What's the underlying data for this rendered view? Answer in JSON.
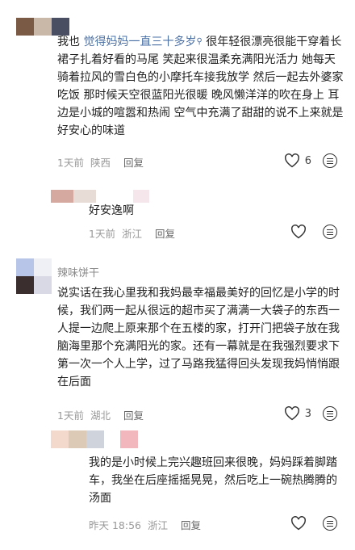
{
  "comments": [
    {
      "name": "",
      "text_prefix": "我也 ",
      "link": "觉得妈妈一直三十多岁",
      "text_rest": " 很年轻很漂亮很能干穿着长裙子扎着好看的马尾 笑起来很温柔充满阳光活力 她每天骑着拉风的雪白色的小摩托车接我放学 然后一起去外婆家吃饭 那时候天空很蓝阳光很暖 晚风懒洋洋的吹在身上 耳边是小城的喧嚣和热闹 空气中充满了甜甜的说不上来就是好安心的味道",
      "time": "1天前",
      "location": "陕西",
      "reply": "回复",
      "likes": "6",
      "avatar_colors": [
        "#7a5a45",
        "#c9b8a8",
        "#4a4e63"
      ]
    },
    {
      "name": "",
      "text": "好安逸啊",
      "time": "1天前",
      "location": "浙江",
      "reply": "回复",
      "likes": "",
      "avatar_colors": [
        "#d6a9a0",
        "#e8dcd6",
        "#f4e6ea"
      ]
    },
    {
      "name": "辣味饼干",
      "text": "说实话在我心里我和我妈最幸福最美好的回忆是小学的时候，我们两一起从很远的超市买了满满一大袋子的东西一人提一边爬上原来那个在五楼的家，打开门把袋子放在我脑海里那个充满阳光的家。还有一幕就是在我强烈要求下第一次一个人上学，过了马路我猛得回头发现我妈悄悄跟在后面",
      "time": "1天前",
      "location": "湖北",
      "reply": "回复",
      "likes": "3",
      "avatar_colors": [
        "#b7c6e8",
        "#3a2f2e",
        "#d9d9e6"
      ]
    },
    {
      "name": "",
      "text": "我的是小时候上完兴趣班回来很晚，妈妈踩着脚踏车，我坐在后座摇摇晃晃，然后吃上一碗热腾腾的汤面",
      "time": "昨天 18:56",
      "location": "浙江",
      "reply": "回复",
      "likes": "",
      "avatar_colors": [
        "#f2d9cc",
        "#dcc9b6",
        "#cfd3dc",
        "#f1b7bd"
      ]
    }
  ],
  "icons": {
    "like": "heart-outline-icon",
    "more": "comment-menu-icon"
  }
}
